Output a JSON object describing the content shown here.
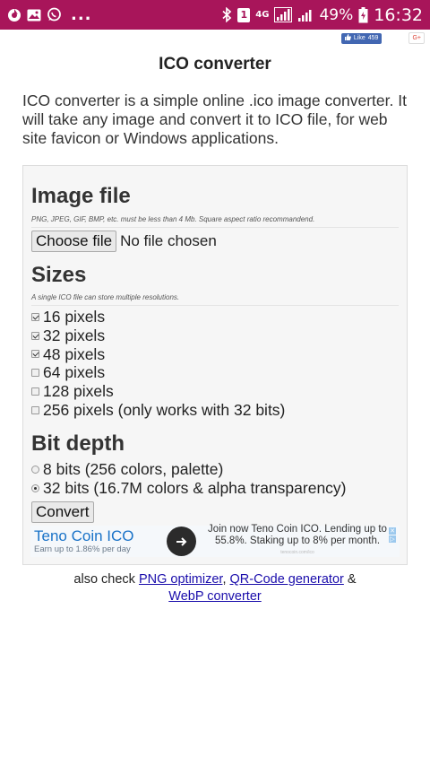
{
  "status_bar": {
    "icons_left": [
      "browser-icon",
      "gallery-icon",
      "whatsapp-icon"
    ],
    "more": "...",
    "sim_slot": "1",
    "network_type": "4G",
    "battery": "49%",
    "time": "16:32"
  },
  "social": {
    "like_label": "Like",
    "like_count": "459",
    "gplus_label": "G+"
  },
  "page": {
    "title": "ICO converter",
    "intro": "ICO converter is a simple online .ico image converter. It will take any image and convert it to ICO file, for web site favicon or Windows applications."
  },
  "form": {
    "image_file": {
      "heading": "Image file",
      "hint": "PNG, JPEG, GIF, BMP, etc. must be less than 4 Mb. Square aspect ratio recommandend.",
      "button": "Choose file",
      "status": "No file chosen"
    },
    "sizes": {
      "heading": "Sizes",
      "hint": "A single ICO file can store multiple resolutions.",
      "options": [
        {
          "label": "16 pixels",
          "checked": true
        },
        {
          "label": "32 pixels",
          "checked": true
        },
        {
          "label": "48 pixels",
          "checked": true
        },
        {
          "label": "64 pixels",
          "checked": false
        },
        {
          "label": "128 pixels",
          "checked": false
        },
        {
          "label": "256 pixels (only works with 32 bits)",
          "checked": false
        }
      ]
    },
    "bit_depth": {
      "heading": "Bit depth",
      "options": [
        {
          "label": "8 bits (256 colors, palette)",
          "checked": false
        },
        {
          "label": "32 bits (16.7M colors & alpha transparency)",
          "checked": true
        }
      ]
    },
    "convert_button": "Convert"
  },
  "ad": {
    "title": "Teno Coin ICO",
    "subtitle": "Earn up to 1.86% per day",
    "body": "Join now Teno Coin ICO. Lending up to 55.8%. Staking up to 8% per month.",
    "domain": "tenocoin.com/ico"
  },
  "footer": {
    "prefix": "also check",
    "link1": "PNG optimizer",
    "sep": ",",
    "link2": "QR-Code generator",
    "amp": "&",
    "link3": "WebP converter"
  }
}
